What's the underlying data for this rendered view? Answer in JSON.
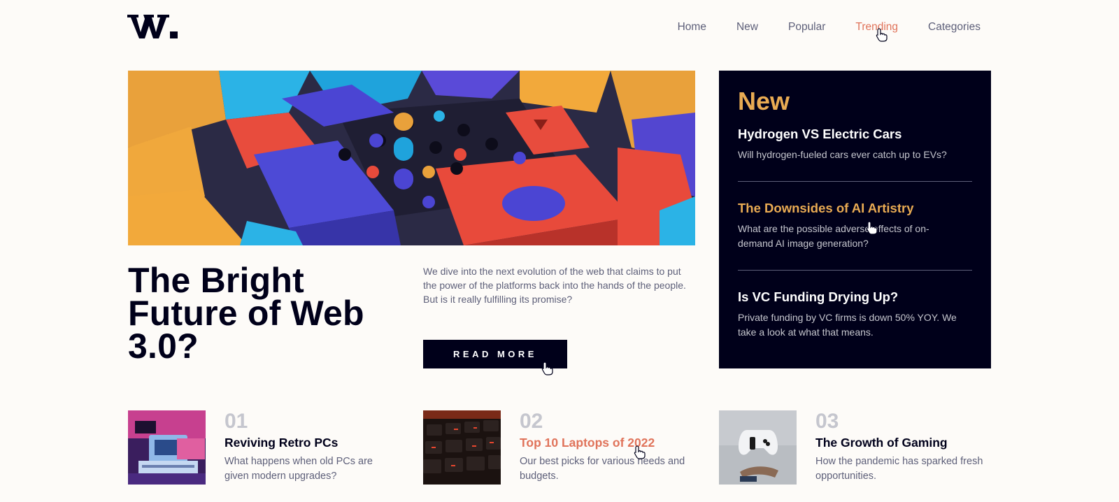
{
  "header": {
    "logo_text": "W.",
    "nav": [
      {
        "label": "Home"
      },
      {
        "label": "New"
      },
      {
        "label": "Popular"
      },
      {
        "label": "Trending"
      },
      {
        "label": "Categories"
      }
    ]
  },
  "hero": {
    "image_icon": "abstract-blocks-image",
    "title": "The Bright Future of Web 3.0?",
    "description": "We dive into the next evolution of the web that claims to put the power of the platforms back into the hands of the people. But is it really fulfilling its promise?",
    "button_label": "READ MORE"
  },
  "news": {
    "title": "New",
    "items": [
      {
        "title": "Hydrogen VS Electric Cars",
        "desc": "Will hydrogen-fueled cars ever catch up to EVs?"
      },
      {
        "title": "The Downsides of AI Artistry",
        "desc": "What are the possible adverse effects of on-demand AI image generation?"
      },
      {
        "title": "Is VC Funding Drying Up?",
        "desc": "Private funding by VC firms is down 50% YOY. We take a look at what that means."
      }
    ]
  },
  "cards": [
    {
      "num": "01",
      "title": "Reviving Retro PCs",
      "desc": "What happens when old PCs are given modern upgrades?",
      "image_icon": "retro-pc-image"
    },
    {
      "num": "02",
      "title": "Top 10 Laptops of 2022",
      "desc": "Our best picks for various needs and budgets.",
      "image_icon": "laptop-keyboard-image"
    },
    {
      "num": "03",
      "title": "The Growth of Gaming",
      "desc": "How the pandemic has sparked fresh opportunities.",
      "image_icon": "game-controller-image"
    }
  ],
  "colors": {
    "background": "#fdfbf8",
    "navy": "#00001a",
    "soft_orange": "#e9ab53",
    "soft_red": "#e0735a",
    "grayish_blue": "#5d5f79",
    "light_gray": "#c5c6ce"
  }
}
